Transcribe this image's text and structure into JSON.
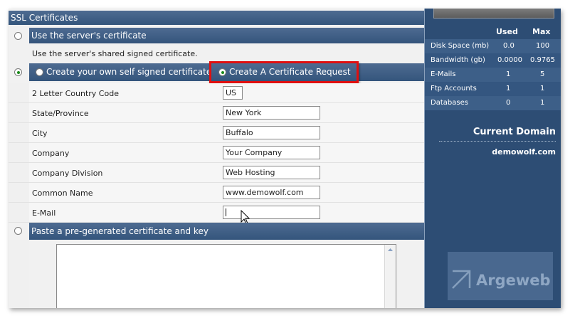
{
  "ssl": {
    "title": "SSL Certificates",
    "use_server": {
      "label": "Use the server's certificate",
      "desc": "Use the server's shared signed certificate."
    },
    "self_signed_label": "Create your own self signed certificate",
    "cert_request_label": "Create A Certificate Request",
    "paste_label": "Paste a pre-generated certificate and key",
    "fields": [
      {
        "label": "2 Letter Country Code",
        "value": "US"
      },
      {
        "label": "State/Province",
        "value": "New York"
      },
      {
        "label": "City",
        "value": "Buffalo"
      },
      {
        "label": "Company",
        "value": "Your Company"
      },
      {
        "label": "Company Division",
        "value": "Web Hosting"
      },
      {
        "label": "Common Name",
        "value": "www.demowolf.com"
      },
      {
        "label": "E-Mail",
        "value": ""
      }
    ]
  },
  "sidebar": {
    "headers": {
      "used": "Used",
      "max": "Max"
    },
    "stats": [
      {
        "name": "Disk Space (mb)",
        "used": "0.0",
        "max": "100"
      },
      {
        "name": "Bandwidth (gb)",
        "used": "0.0000",
        "max": "0.9765"
      },
      {
        "name": "E-Mails",
        "used": "1",
        "max": "5"
      },
      {
        "name": "Ftp Accounts",
        "used": "1",
        "max": "1"
      },
      {
        "name": "Databases",
        "used": "0",
        "max": "1"
      }
    ],
    "current_domain_title": "Current Domain",
    "current_domain": "demowolf.com",
    "logo_text": "Argeweb"
  },
  "colors": {
    "header_bar": "#3e5e86",
    "sidebar": "#2d4d74",
    "highlight": "#e01010"
  }
}
